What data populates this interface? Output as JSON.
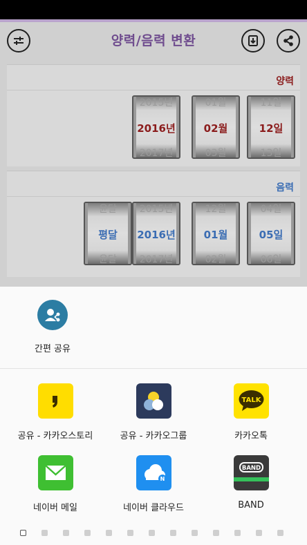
{
  "app": {
    "title": "양력/음력 변환",
    "icons": {
      "settings": "sliders-icon",
      "save": "download-icon",
      "share": "share-icon"
    }
  },
  "solar": {
    "label": "양력",
    "label_color": "#8b1d1d",
    "wheels": [
      {
        "prev": "2015년",
        "selected": "2016년",
        "next": "2017년"
      },
      {
        "prev": "01월",
        "selected": "02월",
        "next": "03월"
      },
      {
        "prev": "11일",
        "selected": "12일",
        "next": "13일"
      }
    ]
  },
  "lunar": {
    "label": "음력",
    "label_color": "#3b6db3",
    "wheels": [
      {
        "prev": "윤달",
        "selected": "평달",
        "next": "윤달"
      },
      {
        "prev": "2015년",
        "selected": "2016년",
        "next": "2017년"
      },
      {
        "prev": "12월",
        "selected": "01월",
        "next": "02월"
      },
      {
        "prev": "04일",
        "selected": "05일",
        "next": "06일"
      }
    ]
  },
  "share_sheet": {
    "direct": {
      "label": "간편 공유",
      "icon": "simple-share-icon",
      "color": "#2c7da3"
    },
    "apps": [
      {
        "label": "공유 - 카카오스토리",
        "icon": "kakaostory-icon",
        "color": "#ffdd00"
      },
      {
        "label": "공유 - 카카오그룹",
        "icon": "kakaogroup-icon",
        "color": "#2c3a5c"
      },
      {
        "label": "카카오톡",
        "icon": "kakaotalk-icon",
        "color": "#ffe200"
      },
      {
        "label": "네이버 메일",
        "icon": "naver-mail-icon",
        "color": "#3fbf32"
      },
      {
        "label": "네이버 클라우드",
        "icon": "naver-cloud-icon",
        "color": "#1f8ff0"
      },
      {
        "label": "BAND",
        "icon": "band-icon",
        "color": "#3a3a3a"
      }
    ],
    "band_text": "BAND",
    "talk_text": "TALK",
    "page_count": 13,
    "active_page": 1
  }
}
